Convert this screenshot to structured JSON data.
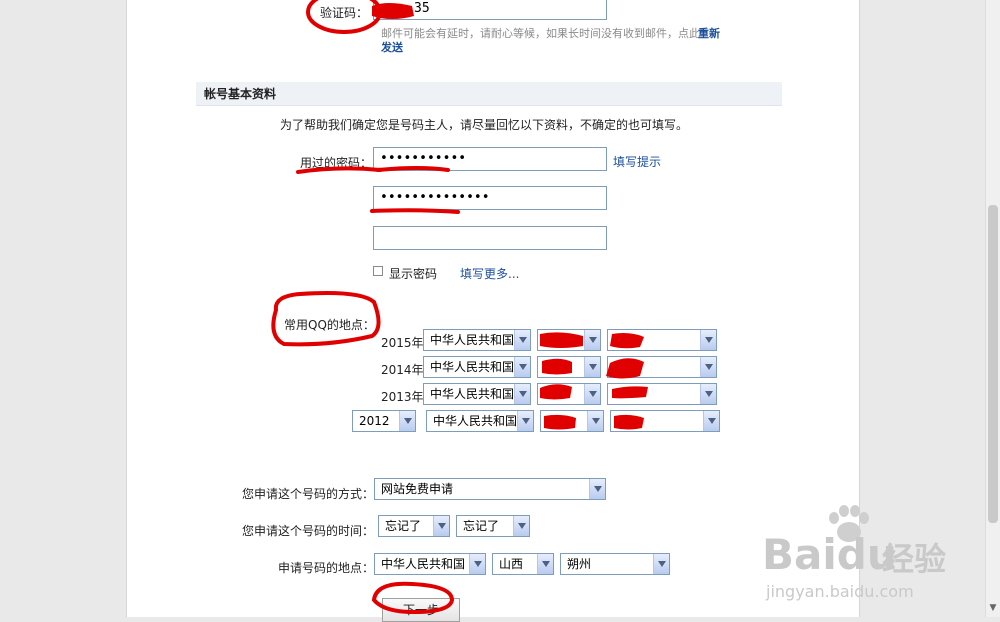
{
  "verification": {
    "label": "验证码：",
    "value": "35",
    "notice": "邮件可能会有延时，请耐心等候，如果长时间没有收到邮件，点此",
    "resend_link_line1": "重新",
    "resend_link_line2": "发送"
  },
  "section": {
    "title": "帐号基本资料",
    "intro": "为了帮助我们确定您是号码主人，请尽量回忆以下资料，不确定的也可填写。"
  },
  "passwords": {
    "label": "用过的密码：",
    "hint_link": "填写提示",
    "value1": "•••••••••••",
    "value2": "••••••••••••••",
    "value3": "",
    "show_label": "显示密码",
    "more_link": "填写更多..."
  },
  "locations": {
    "label": "常用QQ的地点：",
    "rows": [
      {
        "year": "2015年",
        "country": "中华人民共和国"
      },
      {
        "year": "2014年",
        "country": "中华人民共和国"
      },
      {
        "year": "2013年",
        "country": "中华人民共和国"
      },
      {
        "year": "2012",
        "country": "中华人民共和国"
      }
    ]
  },
  "application": {
    "method_label": "您申请这个号码的方式：",
    "method_value": "网站免费申请",
    "time_label": "您申请这个号码的时间：",
    "time_value1": "忘记了",
    "time_value2": "忘记了",
    "place_label": "申请号码的地点：",
    "place_country": "中华人民共和国",
    "place_province": "山西",
    "place_city": "朔州"
  },
  "next_button": "下一步",
  "watermark": {
    "brand": "Baidu",
    "cn": "经验",
    "url": "jingyan.baidu.com"
  },
  "colors": {
    "link": "#1a4f9c",
    "annotation": "#e10000",
    "input_border": "#7f9db9"
  }
}
